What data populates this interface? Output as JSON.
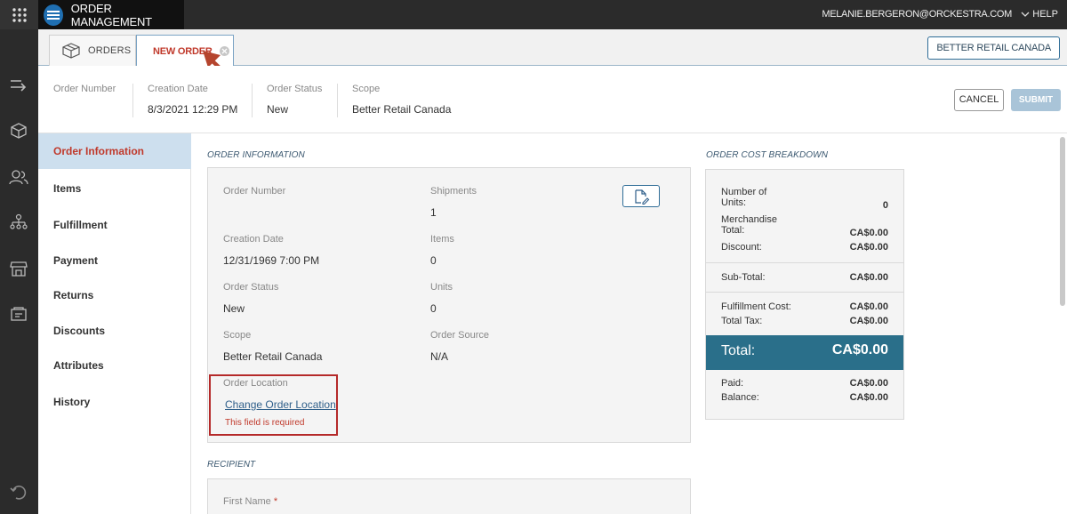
{
  "app": {
    "title": "ORDER MANAGEMENT",
    "user_email": "MELANIE.BERGERON@ORCKESTRA.COM",
    "help": "HELP"
  },
  "tabs": [
    {
      "label": "ORDERS",
      "active": false
    },
    {
      "label": "NEW ORDER",
      "active": true
    }
  ],
  "scope_button": "BETTER RETAIL CANADA",
  "header": {
    "order_number_label": "Order Number",
    "order_number_value": "",
    "creation_date_label": "Creation Date",
    "creation_date_value": "8/3/2021 12:29 PM",
    "order_status_label": "Order Status",
    "order_status_value": "New",
    "scope_label": "Scope",
    "scope_value": "Better Retail Canada",
    "cancel": "CANCEL",
    "submit": "SUBMIT"
  },
  "sidenav": [
    "Order Information",
    "Items",
    "Fulfillment",
    "Payment",
    "Returns",
    "Discounts",
    "Attributes",
    "History"
  ],
  "order_info": {
    "section_title": "ORDER INFORMATION",
    "order_number_label": "Order Number",
    "shipments_label": "Shipments",
    "shipments_value": "1",
    "creation_date_label": "Creation Date",
    "creation_date_value": "12/31/1969 7:00 PM",
    "items_label": "Items",
    "items_value": "0",
    "order_status_label": "Order Status",
    "order_status_value": "New",
    "units_label": "Units",
    "units_value": "0",
    "scope_label": "Scope",
    "scope_value": "Better Retail Canada",
    "order_source_label": "Order Source",
    "order_source_value": "N/A",
    "order_location_label": "Order Location",
    "change_location_link": "Change Order Location",
    "required_error": "This field is required"
  },
  "cost": {
    "section_title": "ORDER COST BREAKDOWN",
    "units_label_1": "Number of",
    "units_label_2": "Units:",
    "units_value": "0",
    "merch_label_1": "Merchandise",
    "merch_label_2": "Total:",
    "merch_value": "CA$0.00",
    "discount_label": "Discount:",
    "discount_value": "CA$0.00",
    "subtotal_label": "Sub-Total:",
    "subtotal_value": "CA$0.00",
    "fulfillment_label": "Fulfillment Cost:",
    "fulfillment_value": "CA$0.00",
    "tax_label": "Total Tax:",
    "tax_value": "CA$0.00",
    "total_label": "Total:",
    "total_value": "CA$0.00",
    "paid_label": "Paid:",
    "paid_value": "CA$0.00",
    "balance_label": "Balance:",
    "balance_value": "CA$0.00"
  },
  "recipient": {
    "section_title": "RECIPIENT",
    "first_name_label": "First Name",
    "required_marker": "*"
  },
  "colors": {
    "topbar": "#2b2b2b",
    "accent_red": "#c0392b",
    "nav_active_bg": "#cddfee",
    "total_bar": "#2a6f8a",
    "link_blue": "#2f5f8a"
  }
}
